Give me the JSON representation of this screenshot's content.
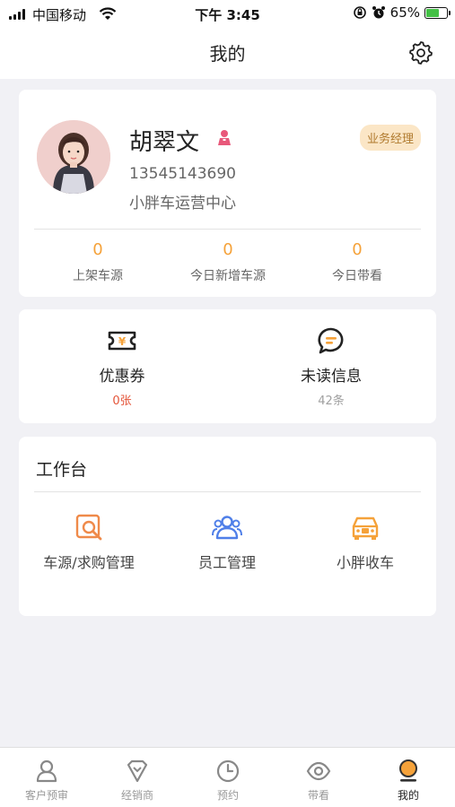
{
  "status_bar": {
    "carrier": "中国移动",
    "time": "下午 3:45",
    "battery": "65%"
  },
  "header": {
    "title": "我的"
  },
  "profile": {
    "name": "胡翠文",
    "role_badge": "业务经理",
    "phone": "13545143690",
    "org": "小胖车运营中心",
    "stats": [
      {
        "value": "0",
        "label": "上架车源"
      },
      {
        "value": "0",
        "label": "今日新增车源"
      },
      {
        "value": "0",
        "label": "今日带看"
      }
    ]
  },
  "quick": {
    "coupon": {
      "label": "优惠券",
      "count": "0张",
      "color": "#e4553a"
    },
    "unread": {
      "label": "未读信息",
      "count": "42条",
      "color": "#a0a0a0"
    }
  },
  "workbench": {
    "title": "工作台",
    "tools": [
      {
        "label": "车源/求购管理",
        "icon": "car-source-search-icon"
      },
      {
        "label": "员工管理",
        "icon": "staff-icon"
      },
      {
        "label": "小胖收车",
        "icon": "car-collect-icon"
      }
    ]
  },
  "tabbar": {
    "tabs": [
      {
        "label": "客户预审",
        "icon": "customer-icon"
      },
      {
        "label": "经销商",
        "icon": "dealer-icon"
      },
      {
        "label": "预约",
        "icon": "clock-icon"
      },
      {
        "label": "带看",
        "icon": "eye-icon"
      },
      {
        "label": "我的",
        "icon": "me-icon",
        "active": true
      }
    ]
  },
  "colors": {
    "accent": "#f5a23a",
    "coupon_red": "#e4553a",
    "staff_blue": "#4f7fe8",
    "tool_orange": "#ef8a4a"
  }
}
